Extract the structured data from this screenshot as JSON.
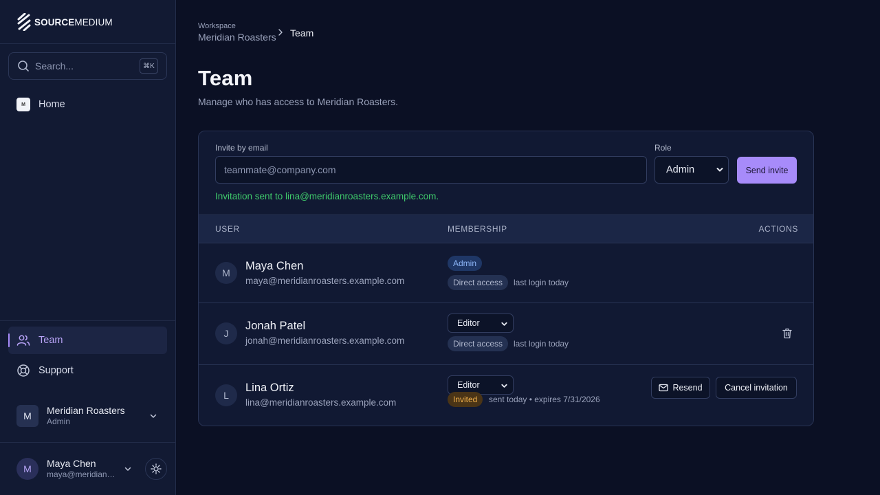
{
  "brand": {
    "name_bold": "SOURCE",
    "name_light": "MEDIUM"
  },
  "search": {
    "placeholder": "Search...",
    "shortcut": "⌘K"
  },
  "nav": {
    "home": "Home",
    "team": "Team",
    "support": "Support"
  },
  "org": {
    "initial": "M",
    "name": "Meridian Roasters",
    "role": "Admin"
  },
  "current_user": {
    "initial": "M",
    "name": "Maya Chen",
    "email": "maya@meridianroasters.example.com"
  },
  "breadcrumb": {
    "section": "Workspace",
    "workspace": "Meridian Roasters",
    "current": "Team"
  },
  "page": {
    "title": "Team",
    "subtitle": "Manage who has access to Meridian Roasters."
  },
  "invite": {
    "email_label": "Invite by email",
    "email_placeholder": "teammate@company.com",
    "role_label": "Role",
    "role_value": "Admin",
    "send_label": "Send invite",
    "success_message": "Invitation sent to lina@meridianroasters.example.com."
  },
  "table": {
    "headers": {
      "user": "USER",
      "membership": "MEMBERSHIP",
      "actions": "ACTIONS"
    },
    "rows": [
      {
        "initial": "M",
        "name": "Maya Chen",
        "email": "maya@meridianroasters.example.com",
        "role": "Admin",
        "access": "Direct access",
        "meta": "last login today"
      },
      {
        "initial": "J",
        "name": "Jonah Patel",
        "email": "jonah@meridianroasters.example.com",
        "role": "Editor",
        "access": "Direct access",
        "meta": "last login today"
      },
      {
        "initial": "L",
        "name": "Lina Ortiz",
        "email": "lina@meridianroasters.example.com",
        "role": "Editor",
        "status": "Invited",
        "meta": "sent today • expires 7/31/2026",
        "resend_label": "Resend",
        "cancel_label": "Cancel invitation"
      }
    ]
  },
  "colors": {
    "accent": "#a78bfa",
    "success": "#3fca6b",
    "invited": "#f2b14b",
    "admin_badge": "#8ab3f5"
  }
}
